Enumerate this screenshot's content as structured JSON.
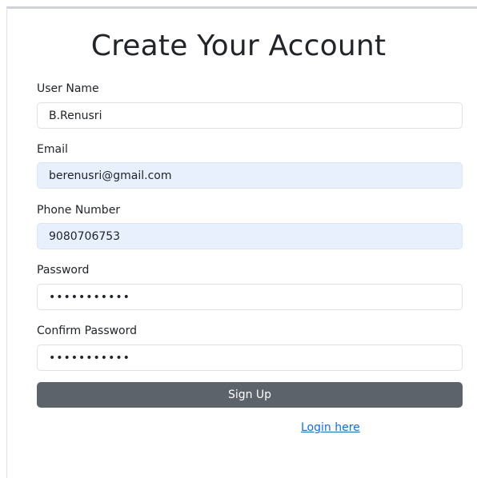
{
  "title": "Create Your Account",
  "fields": {
    "username": {
      "label": "User Name",
      "value": "B.Renusri"
    },
    "email": {
      "label": "Email",
      "value": "berenusri@gmail.com"
    },
    "phone": {
      "label": "Phone Number",
      "value": "9080706753"
    },
    "password": {
      "label": "Password",
      "value": "•••••••••••"
    },
    "confirm_password": {
      "label": "Confirm Password",
      "value": "•••••••••••"
    }
  },
  "signup_button": "Sign Up",
  "login_link": "Login here",
  "colors": {
    "button": "#5c636a",
    "link": "#0d6efd",
    "autofill": "#e8f0fe"
  }
}
